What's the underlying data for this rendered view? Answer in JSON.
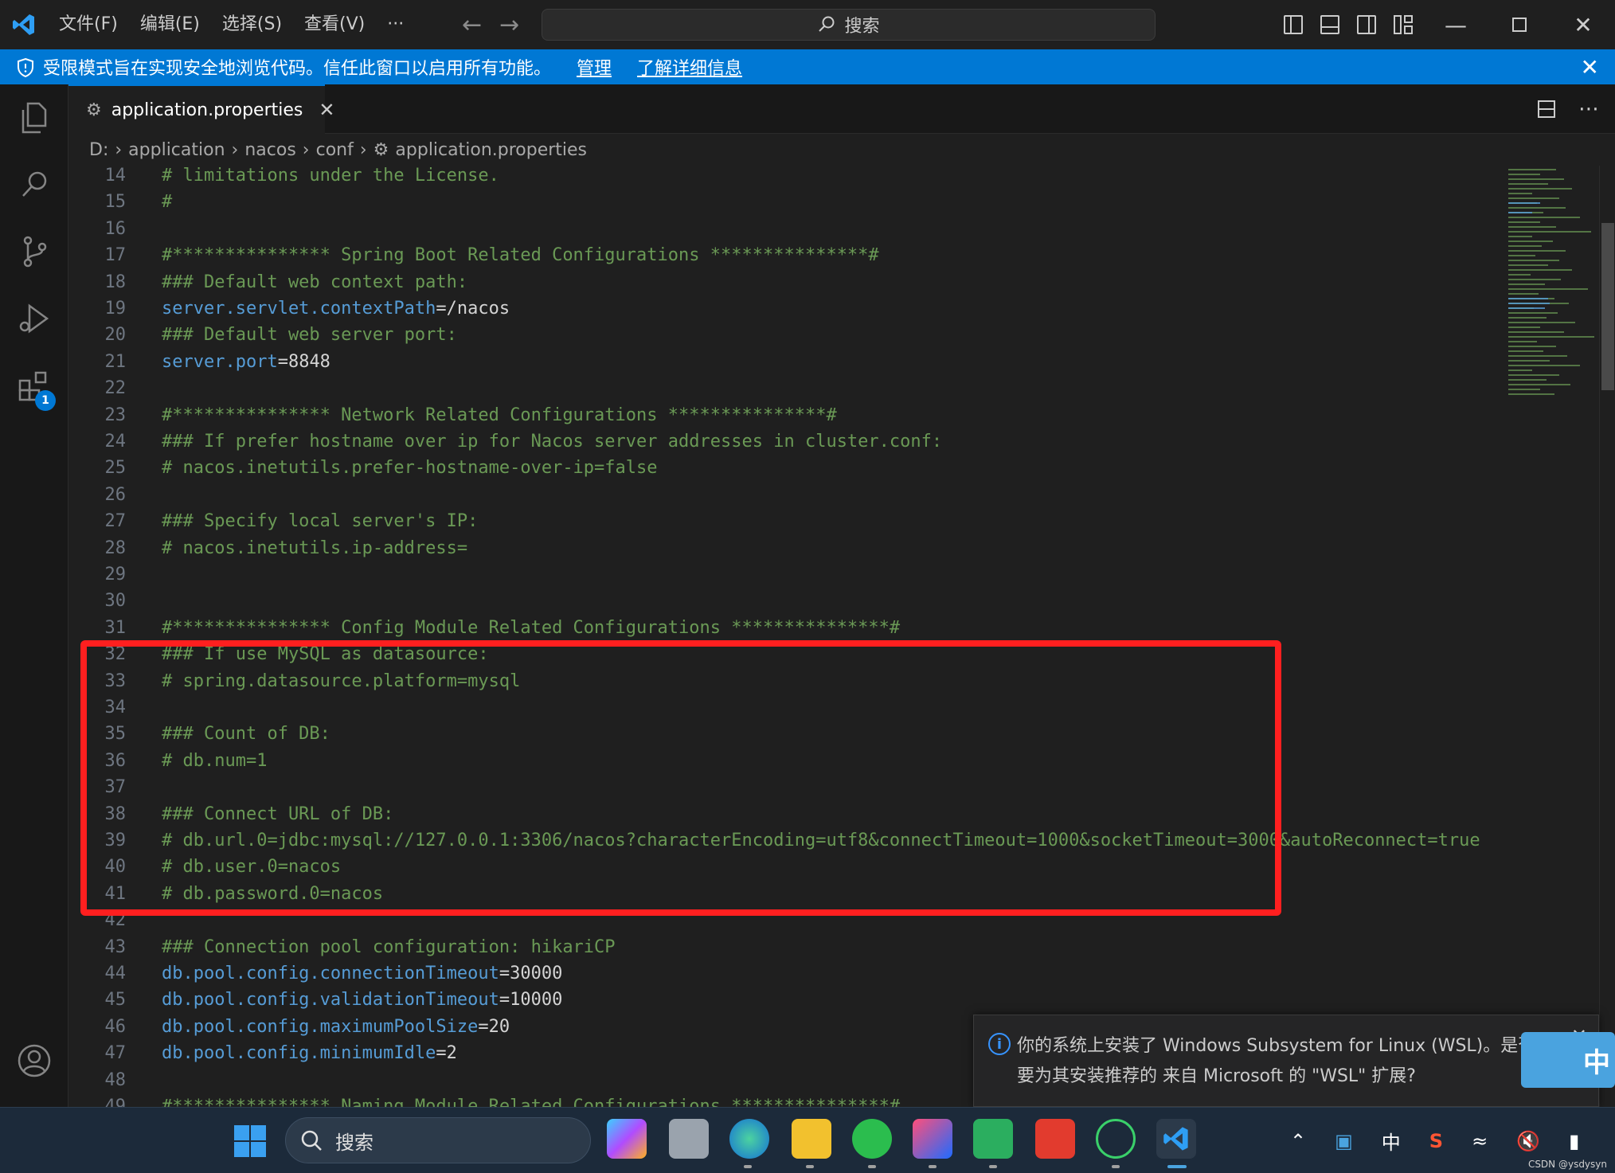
{
  "titlebar": {
    "menu": [
      "文件(F)",
      "编辑(E)",
      "选择(S)",
      "查看(V)",
      "···"
    ],
    "search_label": "搜索"
  },
  "banner": {
    "text": "受限模式旨在实现安全地浏览代码。信任此窗口以启用所有功能。",
    "link_manage": "管理",
    "link_learn": "了解详细信息"
  },
  "activity": {
    "extensions_badge": "1"
  },
  "tab": {
    "label": "application.properties"
  },
  "breadcrumb": [
    "D:",
    "application",
    "nacos",
    "conf",
    "application.properties"
  ],
  "editor": {
    "lines": [
      {
        "n": "14",
        "parts": [
          {
            "t": "# limitations under the License.",
            "c": "comment"
          }
        ]
      },
      {
        "n": "15",
        "parts": [
          {
            "t": "#",
            "c": "comment"
          }
        ]
      },
      {
        "n": "16",
        "parts": []
      },
      {
        "n": "17",
        "parts": [
          {
            "t": "#*************** Spring Boot Related Configurations ***************#",
            "c": "comment"
          }
        ]
      },
      {
        "n": "18",
        "parts": [
          {
            "t": "### Default web context path:",
            "c": "comment"
          }
        ]
      },
      {
        "n": "19",
        "parts": [
          {
            "t": "server.servlet.contextPath",
            "c": "key"
          },
          {
            "t": "=/nacos",
            "c": "val"
          }
        ]
      },
      {
        "n": "20",
        "parts": [
          {
            "t": "### Default web server port:",
            "c": "comment"
          }
        ]
      },
      {
        "n": "21",
        "parts": [
          {
            "t": "server.port",
            "c": "key"
          },
          {
            "t": "=8848",
            "c": "val"
          }
        ]
      },
      {
        "n": "22",
        "parts": []
      },
      {
        "n": "23",
        "parts": [
          {
            "t": "#*************** Network Related Configurations ***************#",
            "c": "comment"
          }
        ]
      },
      {
        "n": "24",
        "parts": [
          {
            "t": "### If prefer hostname over ip for Nacos server addresses in cluster.conf:",
            "c": "comment"
          }
        ]
      },
      {
        "n": "25",
        "parts": [
          {
            "t": "# nacos.inetutils.prefer-hostname-over-ip=false",
            "c": "comment"
          }
        ]
      },
      {
        "n": "26",
        "parts": []
      },
      {
        "n": "27",
        "parts": [
          {
            "t": "### Specify local server's IP:",
            "c": "comment"
          }
        ]
      },
      {
        "n": "28",
        "parts": [
          {
            "t": "# nacos.inetutils.ip-address=",
            "c": "comment"
          }
        ]
      },
      {
        "n": "29",
        "parts": []
      },
      {
        "n": "30",
        "parts": []
      },
      {
        "n": "31",
        "parts": [
          {
            "t": "#*************** Config Module Related Configurations ***************#",
            "c": "comment"
          }
        ]
      },
      {
        "n": "32",
        "parts": [
          {
            "t": "### If use MySQL as datasource:",
            "c": "comment"
          }
        ]
      },
      {
        "n": "33",
        "parts": [
          {
            "t": "# spring.datasource.platform=mysql",
            "c": "comment"
          }
        ]
      },
      {
        "n": "34",
        "parts": []
      },
      {
        "n": "35",
        "parts": [
          {
            "t": "### Count of DB:",
            "c": "comment"
          }
        ]
      },
      {
        "n": "36",
        "parts": [
          {
            "t": "# db.num=1",
            "c": "comment"
          }
        ]
      },
      {
        "n": "37",
        "parts": []
      },
      {
        "n": "38",
        "parts": [
          {
            "t": "### Connect URL of DB:",
            "c": "comment"
          }
        ]
      },
      {
        "n": "39",
        "parts": [
          {
            "t": "# db.url.0=jdbc:mysql://127.0.0.1:3306/nacos?characterEncoding=utf8&connectTimeout=1000&socketTimeout=3000&autoReconnect=true",
            "c": "comment"
          }
        ]
      },
      {
        "n": "40",
        "parts": [
          {
            "t": "# db.user.0=nacos",
            "c": "comment"
          }
        ]
      },
      {
        "n": "41",
        "parts": [
          {
            "t": "# db.password.0=nacos",
            "c": "comment"
          }
        ]
      },
      {
        "n": "42",
        "parts": []
      },
      {
        "n": "43",
        "parts": [
          {
            "t": "### Connection pool configuration: hikariCP",
            "c": "comment"
          }
        ]
      },
      {
        "n": "44",
        "parts": [
          {
            "t": "db.pool.config.connectionTimeout",
            "c": "key"
          },
          {
            "t": "=30000",
            "c": "val"
          }
        ]
      },
      {
        "n": "45",
        "parts": [
          {
            "t": "db.pool.config.validationTimeout",
            "c": "key"
          },
          {
            "t": "=10000",
            "c": "val"
          }
        ]
      },
      {
        "n": "46",
        "parts": [
          {
            "t": "db.pool.config.maximumPoolSize",
            "c": "key"
          },
          {
            "t": "=20",
            "c": "val"
          }
        ]
      },
      {
        "n": "47",
        "parts": [
          {
            "t": "db.pool.config.minimumIdle",
            "c": "key"
          },
          {
            "t": "=2",
            "c": "val"
          }
        ]
      },
      {
        "n": "48",
        "parts": []
      },
      {
        "n": "49",
        "parts": [
          {
            "t": "#*************** Naming Module Related Configurations ***************#",
            "c": "comment"
          }
        ]
      }
    ]
  },
  "toast": {
    "line1": "你的系统上安装了 Windows Subsystem for Linux (WSL)。是否",
    "line2": "要为其安装推荐的 来自 Microsoft 的 \"WSL\" 扩展?"
  },
  "ime_badge": "中",
  "taskbar": {
    "search_label": "搜索",
    "ime_label": "中"
  },
  "watermark": "CSDN @ysdysyn",
  "colors": {
    "accent": "#0078d4",
    "comment": "#6a9955",
    "key": "#569cd6",
    "highlight": "#ff1f1f"
  }
}
